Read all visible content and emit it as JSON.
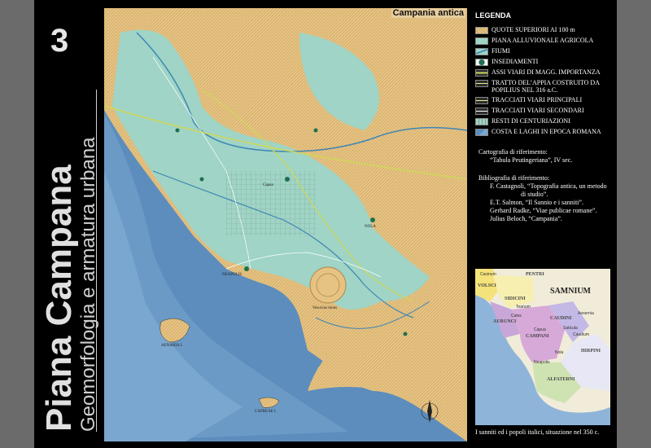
{
  "side_number": "3",
  "vertical_title": "Piana Campana",
  "vertical_subtitle": "Geomorfologia e armatura urbana",
  "map_title": "Campania antica",
  "legend": {
    "title": "LEGENDA",
    "items": [
      {
        "label": "QUOTE SUPERIORI AI 100 m"
      },
      {
        "label": "PIANA ALLUVIONALE AGRICOLA"
      },
      {
        "label": "FIUMI"
      },
      {
        "label": "INSEDIAMENTI"
      },
      {
        "label": "ASSI VIARI DI MAGG. IMPORTANZA"
      },
      {
        "label": "TRATTO DEL’APPIA COSTRUITO DA POPILIUS NEL 316 a.C."
      },
      {
        "label": "TRACCIATI VIARI PRINCIPALI"
      },
      {
        "label": "TRACCIATI VIARI SECONDARI"
      },
      {
        "label": "RESTI DI CENTURIAZIONI"
      },
      {
        "label": "COSTA E LAGHI IN EPOCA ROMANA"
      }
    ]
  },
  "cartography": {
    "line1": "Cartografia di riferimento:",
    "line2": "“Tabula Peutingeriana”, IV sec."
  },
  "bibliography": {
    "heading": "Bibliografia di riferimento:",
    "line1": "F. Castagnoli, “Topografia antica, un metodo",
    "line1b": "di studio”.",
    "line2": "E.T. Salmon, “Il Sannio e i sanniti”.",
    "line3": "Gerhard Radke, “Viae publicae romane”.",
    "line4": "Julius Beloch, “Campania”."
  },
  "inset_caption": "I sanniti ed i popoli italici, situazione nel 350 c.",
  "inset_labels": {
    "samnium": "SAMNIUM",
    "pentri": "PENTRI",
    "sidicini": "SIDICINI",
    "aurunci": "AURUNCI",
    "volsci": "VOLSCI",
    "caudini": "CAUDINI",
    "hirpini": "HIRPINI",
    "campani": "CAMPANI",
    "alfaterni": "ALFATERNI",
    "casinum": "Casinum",
    "teanum": "Teanum",
    "cales": "Cales",
    "capua": "Capua",
    "nola": "Nola",
    "neapolis": "Neapolis",
    "saticula": "Saticula",
    "caudium": "Caudium",
    "aesernia": "Aesernia"
  },
  "map_labels": {
    "ischia": "AENARIA I.",
    "capri": "CAPREAE I.",
    "vesuvius": "Vesuvius mons",
    "capua": "Capua",
    "neapolis": "NEAPOLIS",
    "nola": "NOLA"
  },
  "colors": {
    "hills": "#e6c383",
    "plain": "#9fd4c6",
    "sea": "#5c8dbd",
    "rivers": "#3f86b4",
    "settlements": "#1e6f4d",
    "roads": "#cfd75b",
    "roads_secondary": "#ffffff",
    "centuriation": "#7f9a80"
  }
}
